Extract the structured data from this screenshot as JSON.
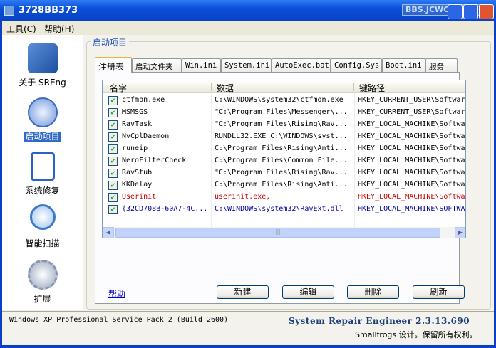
{
  "window": {
    "title": "3728BB373",
    "watermark": "BBS.JCWCN.COM"
  },
  "menu": [
    "工具(C)",
    "帮助(H)"
  ],
  "sidebar": [
    {
      "label": "关于 SREng"
    },
    {
      "label": "启动项目"
    },
    {
      "label": "系统修复"
    },
    {
      "label": "智能扫描"
    },
    {
      "label": "扩展"
    }
  ],
  "group_label": "启动项目",
  "tabs": [
    "注册表",
    "启动文件夹",
    "Win.ini",
    "System.ini",
    "AutoExec.bat",
    "Config.Sys",
    "Boot.ini",
    "服务"
  ],
  "columns": [
    "名字",
    "数据",
    "键路径"
  ],
  "rows": [
    {
      "name": "ctfmon.exe",
      "data": "C:\\WINDOWS\\system32\\ctfmon.exe",
      "path": "HKEY_CURRENT_USER\\Softwar",
      "color": "#000000"
    },
    {
      "name": "MSMSGS",
      "data": "\"C:\\Program Files\\Messenger\\...",
      "path": "HKEY_CURRENT_USER\\Softwar",
      "color": "#000000"
    },
    {
      "name": "RavTask",
      "data": "\"C:\\Program Files\\Rising\\Rav...",
      "path": "HKEY_LOCAL_MACHINE\\Softwa",
      "color": "#000000"
    },
    {
      "name": "NvCplDaemon",
      "data": "RUNDLL32.EXE C:\\WINDOWS\\syst...",
      "path": "HKEY_LOCAL_MACHINE\\Softwa",
      "color": "#000000"
    },
    {
      "name": "runeip",
      "data": "C:\\Program Files\\Rising\\Anti...",
      "path": "HKEY_LOCAL_MACHINE\\Softwa",
      "color": "#000000"
    },
    {
      "name": "NeroFilterCheck",
      "data": "C:\\Program Files\\Common File...",
      "path": "HKEY_LOCAL_MACHINE\\Softwa",
      "color": "#000000"
    },
    {
      "name": "RavStub",
      "data": "\"C:\\Program Files\\Rising\\Rav...",
      "path": "HKEY_LOCAL_MACHINE\\Softwa",
      "color": "#000000"
    },
    {
      "name": "KKDelay",
      "data": "C:\\Program Files\\Rising\\Anti...",
      "path": "HKEY_LOCAL_MACHINE\\Softwa",
      "color": "#000000"
    },
    {
      "name": "Userinit",
      "data": "userinit.exe,",
      "path": "HKEY_LOCAL_MACHINE\\Softwa",
      "color": "#c00000"
    },
    {
      "name": "{32CD708B-60A7-4C...",
      "data": "C:\\WINDOWS\\system32\\RavExt.dll",
      "path": "HKEY_LOCAL_MACHINE\\SOFTWA",
      "color": "#0000a0"
    }
  ],
  "help_link": "帮助",
  "buttons": [
    "新建",
    "编辑",
    "删除",
    "刷新"
  ],
  "status": {
    "os": "Windows XP Professional Service Pack 2 (Build 2600)",
    "product": "System Repair Engineer 2.3.13.690",
    "copyright": "Smallfrogs 设计。保留所有权利。"
  }
}
